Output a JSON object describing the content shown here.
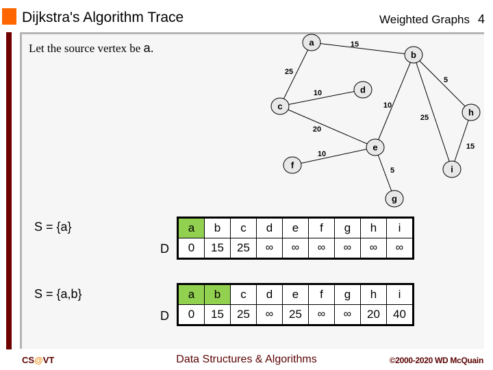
{
  "header": {
    "title": "Dijkstra's Algorithm Trace",
    "subtitle": "Weighted Graphs",
    "page_number": "4"
  },
  "intro": {
    "text": "Let the source vertex be ",
    "vertex": "a."
  },
  "colors": {
    "accent_square": "#ff6600",
    "side_bar": "#6e0000",
    "in_set_highlight": "#92d050",
    "node_fill": "#e8e8e8",
    "footer_text": "#5a0000",
    "footer_at": "#f09020"
  },
  "graph": {
    "nodes": [
      {
        "id": "a",
        "label": "a"
      },
      {
        "id": "b",
        "label": "b"
      },
      {
        "id": "c",
        "label": "c"
      },
      {
        "id": "d",
        "label": "d"
      },
      {
        "id": "e",
        "label": "e"
      },
      {
        "id": "f",
        "label": "f"
      },
      {
        "id": "g",
        "label": "g"
      },
      {
        "id": "h",
        "label": "h"
      },
      {
        "id": "i",
        "label": "i"
      }
    ],
    "edges": [
      {
        "from": "a",
        "to": "b",
        "weight": "15"
      },
      {
        "from": "a",
        "to": "c",
        "weight": "25"
      },
      {
        "from": "c",
        "to": "d",
        "weight": "10"
      },
      {
        "from": "c",
        "to": "e",
        "weight": "20"
      },
      {
        "from": "b",
        "to": "e",
        "weight": "10"
      },
      {
        "from": "b",
        "to": "i",
        "weight": "25"
      },
      {
        "from": "b",
        "to": "h",
        "weight": "5"
      },
      {
        "from": "h",
        "to": "i",
        "weight": "15"
      },
      {
        "from": "e",
        "to": "f",
        "weight": "10"
      },
      {
        "from": "e",
        "to": "g",
        "weight": "5"
      }
    ]
  },
  "steps": [
    {
      "set_label": "S = {a}",
      "row_label": "D",
      "vertices": [
        "a",
        "b",
        "c",
        "d",
        "e",
        "f",
        "g",
        "h",
        "i"
      ],
      "in_set": [
        true,
        false,
        false,
        false,
        false,
        false,
        false,
        false,
        false
      ],
      "distances": [
        "0",
        "15",
        "25",
        "∞",
        "∞",
        "∞",
        "∞",
        "∞",
        "∞"
      ]
    },
    {
      "set_label": "S = {a,b}",
      "row_label": "D",
      "vertices": [
        "a",
        "b",
        "c",
        "d",
        "e",
        "f",
        "g",
        "h",
        "i"
      ],
      "in_set": [
        true,
        true,
        false,
        false,
        false,
        false,
        false,
        false,
        false
      ],
      "distances": [
        "0",
        "15",
        "25",
        "∞",
        "25",
        "∞",
        "∞",
        "20",
        "40"
      ]
    }
  ],
  "footer": {
    "left_prefix": "CS",
    "left_at": "@",
    "left_suffix": "VT",
    "center": "Data Structures & Algorithms",
    "right": "©2000-2020 WD McQuain"
  }
}
